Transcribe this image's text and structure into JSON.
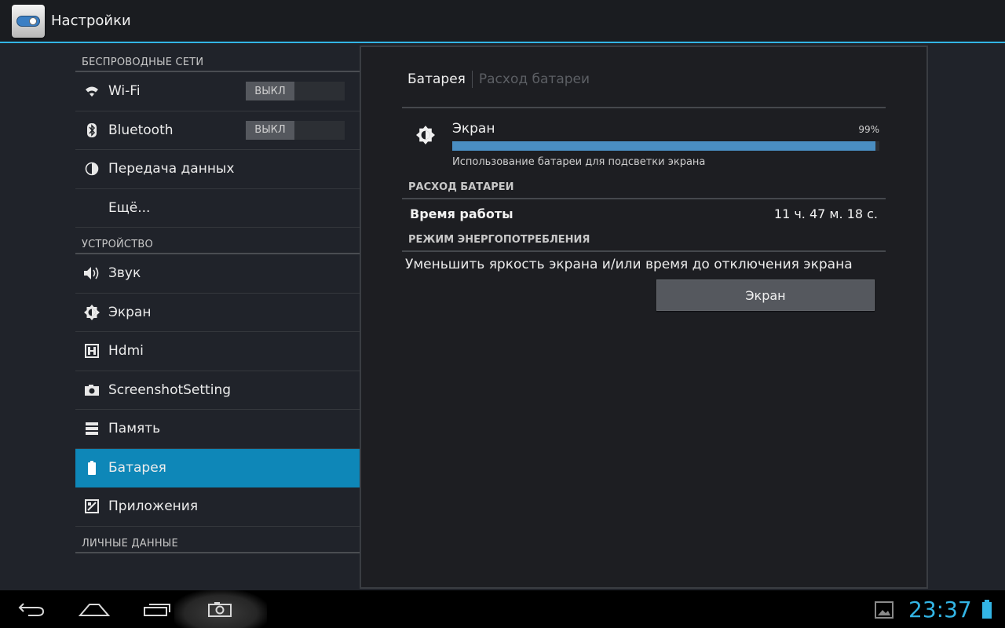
{
  "app": {
    "title": "Настройки"
  },
  "sidebar": {
    "sections": [
      {
        "header": "БЕСПРОВОДНЫЕ СЕТИ",
        "items": [
          {
            "label": "Wi-Fi",
            "icon": "wifi-icon",
            "toggle": "ВЫКЛ"
          },
          {
            "label": "Bluetooth",
            "icon": "bluetooth-icon",
            "toggle": "ВЫКЛ"
          },
          {
            "label": "Передача данных",
            "icon": "data-usage-icon"
          },
          {
            "label": "Ещё..."
          }
        ]
      },
      {
        "header": "УСТРОЙСТВО",
        "items": [
          {
            "label": "Звук",
            "icon": "sound-icon"
          },
          {
            "label": "Экран",
            "icon": "brightness-icon"
          },
          {
            "label": "Hdmi",
            "icon": "hdmi-icon"
          },
          {
            "label": "ScreenshotSetting",
            "icon": "camera-icon"
          },
          {
            "label": "Память",
            "icon": "storage-icon"
          },
          {
            "label": "Батарея",
            "icon": "battery-icon",
            "selected": true
          },
          {
            "label": "Приложения",
            "icon": "apps-icon"
          }
        ]
      },
      {
        "header": "ЛИЧНЫЕ ДАННЫЕ",
        "items": []
      }
    ]
  },
  "detail": {
    "tabs": {
      "active": "Батарея",
      "inactive": "Расход батареи"
    },
    "usage": {
      "name": "Экран",
      "percent_label": "99%",
      "percent": 99,
      "description": "Использование батареи для подсветки экрана"
    },
    "battery_usage_header": "РАСХОД БАТАРЕИ",
    "runtime": {
      "label": "Время работы",
      "value": "11 ч. 47 м. 18 с."
    },
    "power_mode_header": "РЕЖИМ ЭНЕРГОПОТРЕБЛЕНИЯ",
    "power_text": "Уменьшить яркость экрана и/или время до отключения экрана",
    "screen_button": "Экран"
  },
  "statusbar": {
    "time": "23:37"
  },
  "colors": {
    "accent": "#33b5e5",
    "selected": "#0e87b8",
    "progress": "#4a8ec2"
  }
}
